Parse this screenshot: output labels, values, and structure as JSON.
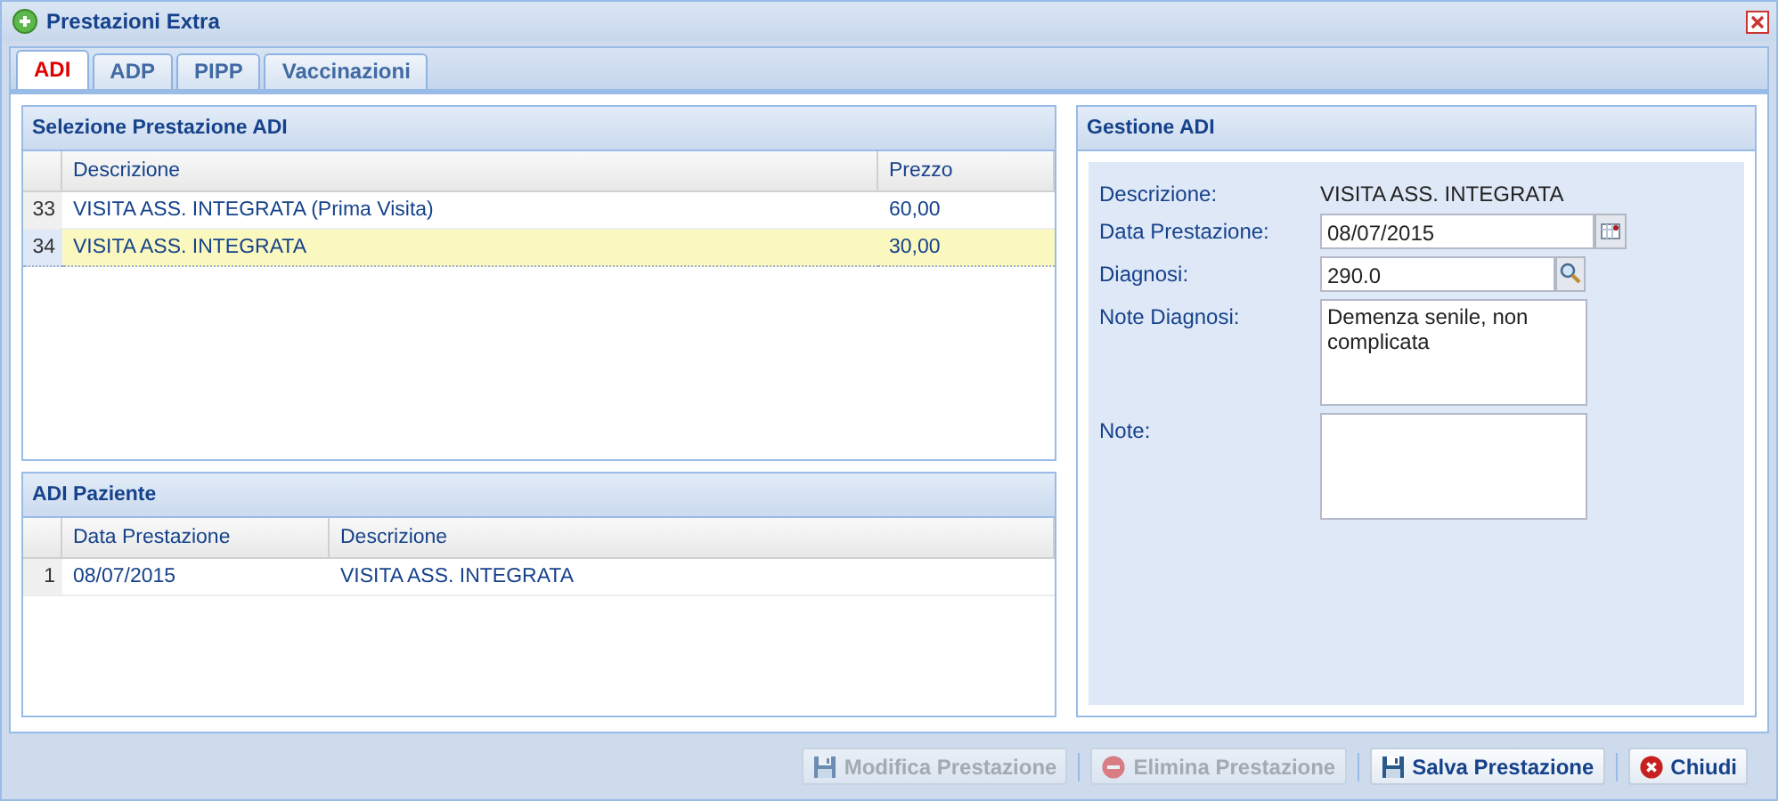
{
  "window": {
    "title": "Prestazioni Extra"
  },
  "tabs": [
    {
      "label": "ADI",
      "selected": true
    },
    {
      "label": "ADP",
      "selected": false
    },
    {
      "label": "PIPP",
      "selected": false
    },
    {
      "label": "Vaccinazioni",
      "selected": false
    }
  ],
  "selection_panel": {
    "title": "Selezione Prestazione ADI",
    "columns": [
      "Descrizione",
      "Prezzo"
    ],
    "rows": [
      {
        "index": "33",
        "description": "VISITA ASS. INTEGRATA (Prima Visita)",
        "price": "60,00",
        "selected": false
      },
      {
        "index": "34",
        "description": "VISITA ASS. INTEGRATA",
        "price": "30,00",
        "selected": true
      }
    ]
  },
  "patient_panel": {
    "title": "ADI Paziente",
    "columns": [
      "Data Prestazione",
      "Descrizione"
    ],
    "rows": [
      {
        "index": "1",
        "date": "08/07/2015",
        "description": "VISITA ASS. INTEGRATA",
        "selected": false
      }
    ]
  },
  "management_panel": {
    "title": "Gestione ADI",
    "fields": [
      {
        "kind": "text",
        "label": "Descrizione:",
        "value": "VISITA ASS. INTEGRATA"
      },
      {
        "kind": "date",
        "label": "Data Prestazione:",
        "value": "08/07/2015"
      },
      {
        "kind": "lookup",
        "label": "Diagnosi:",
        "value": "290.0"
      },
      {
        "kind": "textarea",
        "label": "Note Diagnosi:",
        "value": "Demenza senile, non complicata"
      },
      {
        "kind": "textarea",
        "label": "Note:"
      }
    ]
  },
  "buttons": [
    {
      "kind": "save",
      "label": "Modifica Prestazione",
      "disabled": true
    },
    {
      "kind": "delete",
      "label": "Elimina Prestazione",
      "disabled": true
    },
    {
      "kind": "save",
      "label": "Salva Prestazione",
      "disabled": false
    },
    {
      "kind": "close",
      "label": "Chiudi",
      "disabled": false
    }
  ]
}
